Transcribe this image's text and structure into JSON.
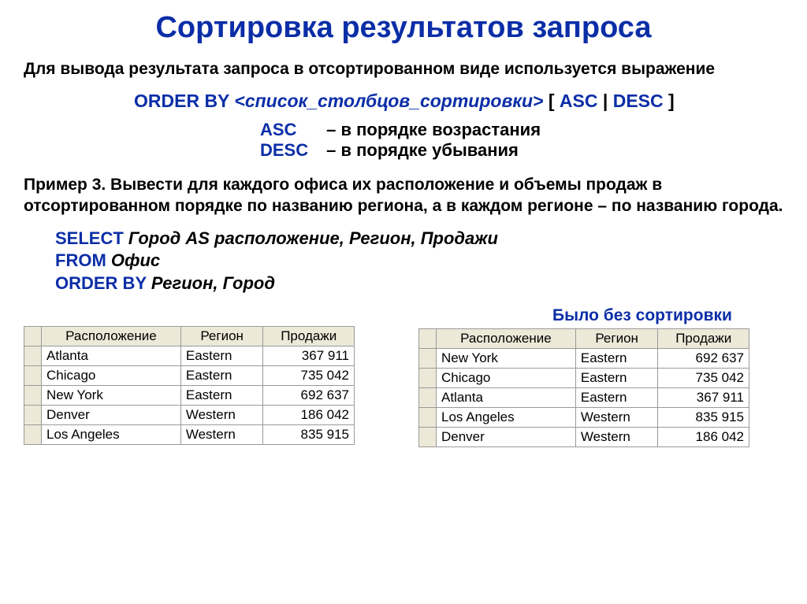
{
  "title": "Сортировка результатов запроса",
  "intro": "Для вывода результата запроса в отсортированном виде используется выражение",
  "syntax": {
    "orderby": "ORDER BY",
    "placeholder": "<список_столбцов_сортировки>",
    "lbracket": "[",
    "asc": "ASC",
    "pipe": "|",
    "desc": "DESC",
    "rbracket": "]"
  },
  "explain": {
    "asc_kw": "ASC",
    "asc_txt": "– в порядке возрастания",
    "desc_kw": "DESC",
    "desc_txt": "– в порядке убывания"
  },
  "example_label": "Пример 3. Вывести для каждого офиса их расположение и объемы продаж в отсортированном порядке по названию региона, а в каждом регионе – по названию города.",
  "sql": {
    "select_kw": "SELECT",
    "select_args": "Город AS расположение, Регион, Продажи",
    "from_kw": "FROM",
    "from_args": "Офис",
    "orderby_kw": "ORDER BY",
    "orderby_args": "Регион, Город"
  },
  "table_headers": {
    "col1": "Расположение",
    "col2": "Регион",
    "col3": "Продажи"
  },
  "sorted_rows": [
    {
      "c1": "Atlanta",
      "c2": "Eastern",
      "c3": "367 911"
    },
    {
      "c1": "Chicago",
      "c2": "Eastern",
      "c3": "735 042"
    },
    {
      "c1": "New York",
      "c2": "Eastern",
      "c3": "692 637"
    },
    {
      "c1": "Denver",
      "c2": "Western",
      "c3": "186 042"
    },
    {
      "c1": "Los Angeles",
      "c2": "Western",
      "c3": "835 915"
    }
  ],
  "unsorted_caption": "Было без сортировки",
  "unsorted_rows": [
    {
      "c1": "New York",
      "c2": "Eastern",
      "c3": "692 637"
    },
    {
      "c1": "Chicago",
      "c2": "Eastern",
      "c3": "735 042"
    },
    {
      "c1": "Atlanta",
      "c2": "Eastern",
      "c3": "367 911"
    },
    {
      "c1": "Los Angeles",
      "c2": "Western",
      "c3": "835 915"
    },
    {
      "c1": "Denver",
      "c2": "Western",
      "c3": "186 042"
    }
  ]
}
